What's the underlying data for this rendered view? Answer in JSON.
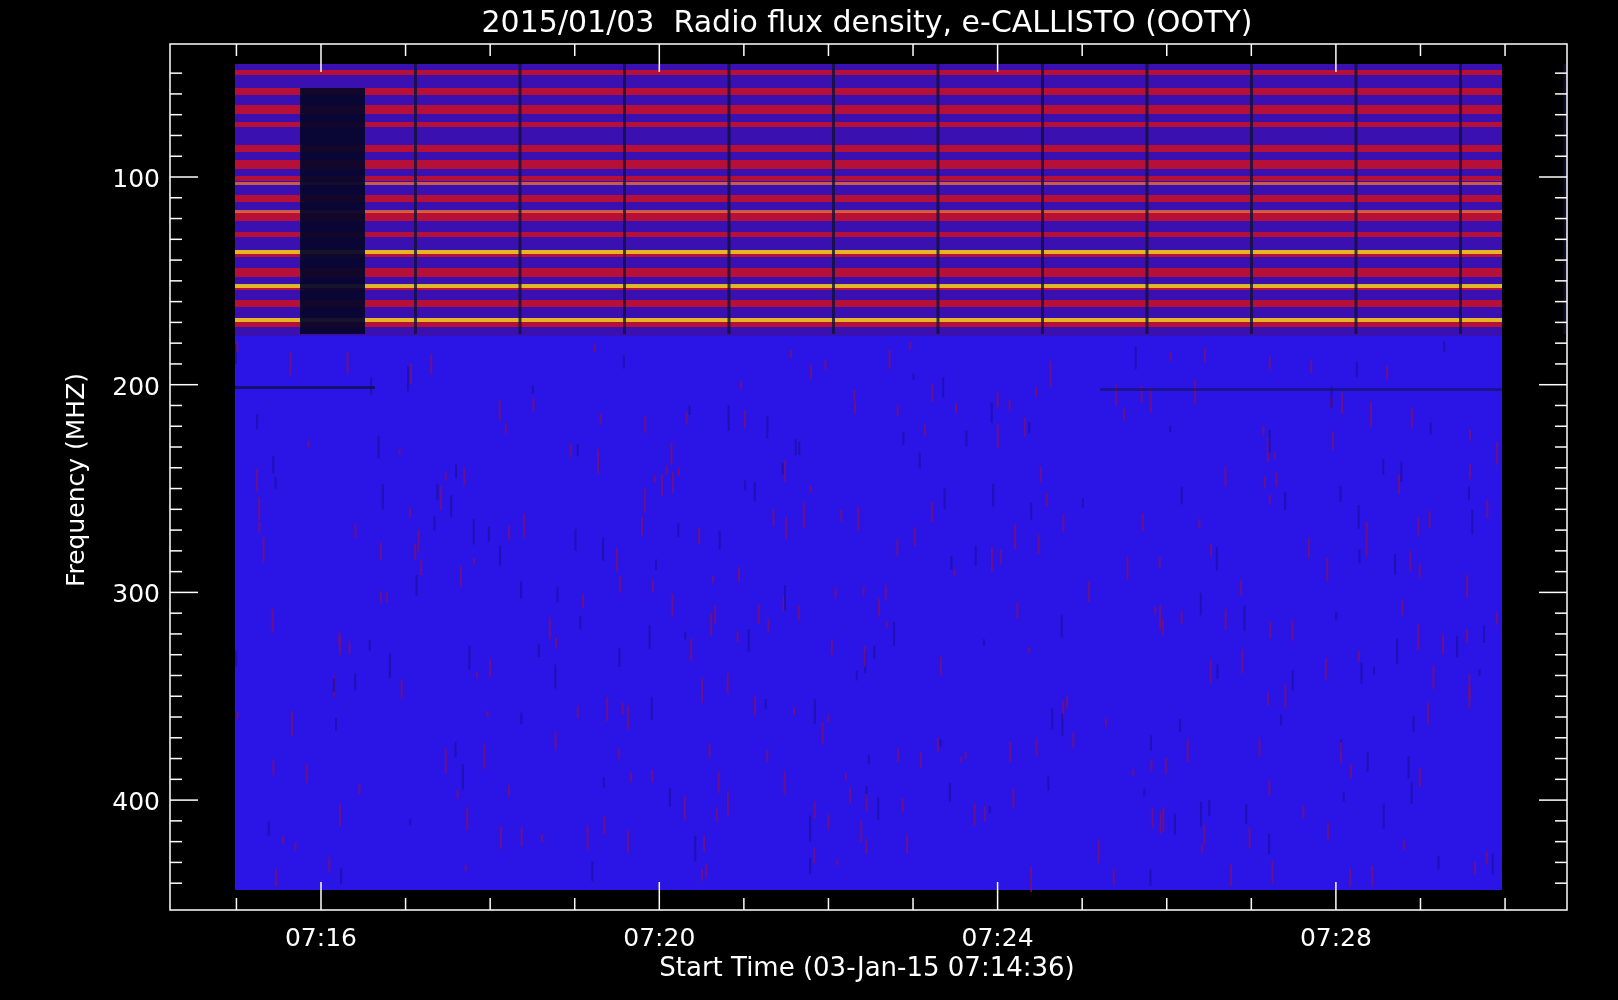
{
  "title": "2015/01/03  Radio flux density, e-CALLISTO (OOTY)",
  "y_axis": {
    "label": "Frequency (MHZ)",
    "ticks": [
      "100",
      "200",
      "300",
      "400"
    ]
  },
  "x_axis": {
    "label": "Start Time (03-Jan-15 07:14:36)",
    "ticks": [
      "07:16",
      "07:20",
      "07:24",
      "07:28"
    ]
  }
}
